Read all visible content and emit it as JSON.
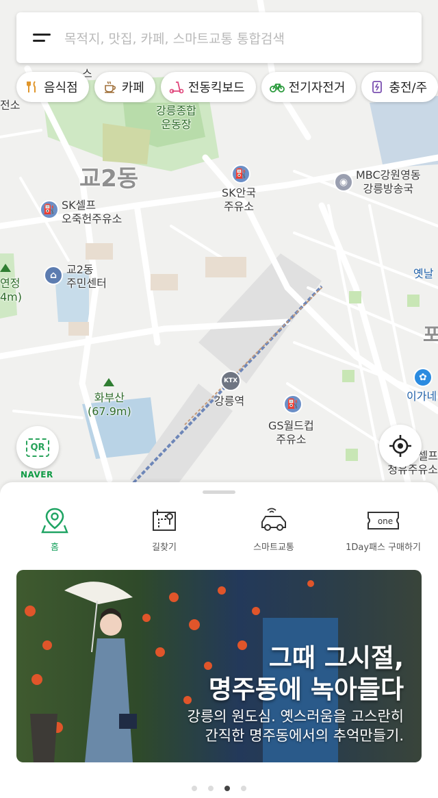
{
  "search": {
    "placeholder": "목적지, 맛집, 카페, 스마트교통 통합검색"
  },
  "chips": [
    {
      "label": "음식점",
      "icon": "utensils-icon"
    },
    {
      "label": "카페",
      "icon": "coffee-cup-icon"
    },
    {
      "label": "전동킥보드",
      "icon": "kickboard-icon"
    },
    {
      "label": "전기자전거",
      "icon": "bicycle-icon"
    },
    {
      "label": "충전/주",
      "icon": "charging-station-icon"
    }
  ],
  "map": {
    "labels": {
      "stadium": "강릉종합\n운동장",
      "district": "교2동",
      "sk_anguk": "SK안국\n주유소",
      "mbc": "MBC강원영동\n강릉방송국",
      "sk_self_ojuk": "SK셀프\n오죽헌주유소",
      "community_center": "교2동\n주민센터",
      "mountain": "화부산\n(67.9m)",
      "station": "강릉역",
      "gs_worldcup": "GS월드컵\n주유소",
      "left_partial_1": "전소",
      "left_partial_2": "연정\n4m)",
      "right_partial_1": "옛날",
      "right_partial_2": "포",
      "right_partial_3": "이가네",
      "right_partial_4": "셀프\n청유주유소",
      "top_partial": "스",
      "ktx_badge": "KTX"
    },
    "qr_label": "QR",
    "brand": "NAVER"
  },
  "tabs": [
    {
      "label": "홈",
      "icon": "map-pin-icon",
      "active": true
    },
    {
      "label": "길찾기",
      "icon": "route-map-icon",
      "active": false
    },
    {
      "label": "스마트교통",
      "icon": "smart-car-icon",
      "active": false
    },
    {
      "label": "1Day패스 구매하기",
      "icon": "one-day-ticket-icon",
      "active": false
    },
    {
      "ticket_text": "one"
    }
  ],
  "banner": {
    "headline_line1": "그때 그시절,",
    "headline_line2": "명주동에 녹아들다",
    "sub_line1": "강릉의 원도심. 옛스러움을 고스란히",
    "sub_line2": "간직한 명주동에서의 추억만들기."
  },
  "carousel": {
    "count": 4,
    "active_index": 2
  },
  "colors": {
    "accent": "#1fa463",
    "naver": "#0f9a44"
  }
}
